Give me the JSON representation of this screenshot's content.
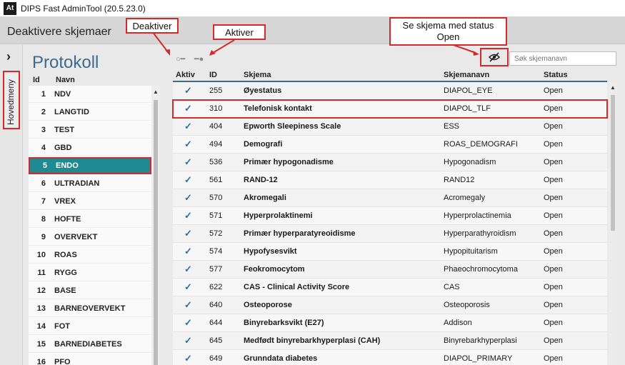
{
  "window": {
    "app_icon_text": "At",
    "title": "DIPS Fast AdminTool (20.5.23.0)"
  },
  "header": {
    "page_title": "Deaktivere skjemaer"
  },
  "sidebar": {
    "toggle_glyph": "›",
    "menu_label": "Hovedmeny"
  },
  "protocol_panel": {
    "title": "Protokoll",
    "columns": {
      "id": "Id",
      "name": "Navn"
    },
    "items": [
      {
        "id": "1",
        "name": "NDV"
      },
      {
        "id": "2",
        "name": "LANGTID"
      },
      {
        "id": "3",
        "name": "TEST"
      },
      {
        "id": "4",
        "name": "GBD"
      },
      {
        "id": "5",
        "name": "ENDO",
        "selected": true
      },
      {
        "id": "6",
        "name": "ULTRADIAN"
      },
      {
        "id": "7",
        "name": "VREX"
      },
      {
        "id": "8",
        "name": "HOFTE"
      },
      {
        "id": "9",
        "name": "OVERVEKT"
      },
      {
        "id": "10",
        "name": "ROAS"
      },
      {
        "id": "11",
        "name": "RYGG"
      },
      {
        "id": "12",
        "name": "BASE"
      },
      {
        "id": "13",
        "name": "BARNEOVERVEKT"
      },
      {
        "id": "14",
        "name": "FOT"
      },
      {
        "id": "15",
        "name": "BARNEDIABETES"
      },
      {
        "id": "16",
        "name": "PFO"
      }
    ]
  },
  "toolbar": {
    "deactivate_glyph": "○━",
    "activate_glyph": "━●",
    "search_placeholder": "Søk skjemanavn"
  },
  "callouts": {
    "deaktiver": "Deaktiver",
    "aktiver": "Aktiver",
    "show_open_line1": "Se skjema med status",
    "show_open_line2": "Open"
  },
  "table": {
    "columns": {
      "active": "Aktiv",
      "id": "ID",
      "form": "Skjema",
      "form_name": "Skjemanavn",
      "status": "Status"
    },
    "check_glyph": "✓",
    "rows": [
      {
        "id": "255",
        "form": "Øyestatus",
        "form_name": "DIAPOL_EYE",
        "status": "Open"
      },
      {
        "id": "310",
        "form": "Telefonisk kontakt",
        "form_name": "DIAPOL_TLF",
        "status": "Open"
      },
      {
        "id": "404",
        "form": "Epworth Sleepiness Scale",
        "form_name": "ESS",
        "status": "Open"
      },
      {
        "id": "494",
        "form": "Demografi",
        "form_name": "ROAS_DEMOGRAFI",
        "status": "Open"
      },
      {
        "id": "536",
        "form": "Primær hypogonadisme",
        "form_name": "Hypogonadism",
        "status": "Open"
      },
      {
        "id": "561",
        "form": "RAND-12",
        "form_name": "RAND12",
        "status": "Open"
      },
      {
        "id": "570",
        "form": "Akromegali",
        "form_name": "Acromegaly",
        "status": "Open"
      },
      {
        "id": "571",
        "form": "Hyperprolaktinemi",
        "form_name": "Hyperprolactinemia",
        "status": "Open"
      },
      {
        "id": "572",
        "form": "Primær hyperparatyreoidisme",
        "form_name": "Hyperparathyroidism",
        "status": "Open"
      },
      {
        "id": "574",
        "form": "Hypofysesvikt",
        "form_name": "Hypopituitarism",
        "status": "Open"
      },
      {
        "id": "577",
        "form": "Feokromocytom",
        "form_name": "Phaeochromocytoma",
        "status": "Open"
      },
      {
        "id": "622",
        "form": "CAS - Clinical Activity Score",
        "form_name": "CAS",
        "status": "Open"
      },
      {
        "id": "640",
        "form": "Osteoporose",
        "form_name": "Osteoporosis",
        "status": "Open"
      },
      {
        "id": "644",
        "form": "Binyrebarksvikt (E27)",
        "form_name": "Addison",
        "status": "Open"
      },
      {
        "id": "645",
        "form": "Medfødt binyrebarkhyperplasi (CAH)",
        "form_name": "Binyrebarkhyperplasi",
        "status": "Open"
      },
      {
        "id": "649",
        "form": "Grunndata diabetes",
        "form_name": "DIAPOL_PRIMARY",
        "status": "Open"
      }
    ]
  },
  "scroll": {
    "up_glyph": "▲"
  },
  "colors": {
    "accent": "#1e8a94",
    "annotation": "#d62a2a",
    "header_text": "#3e6a8f",
    "check": "#2a6fa3"
  }
}
